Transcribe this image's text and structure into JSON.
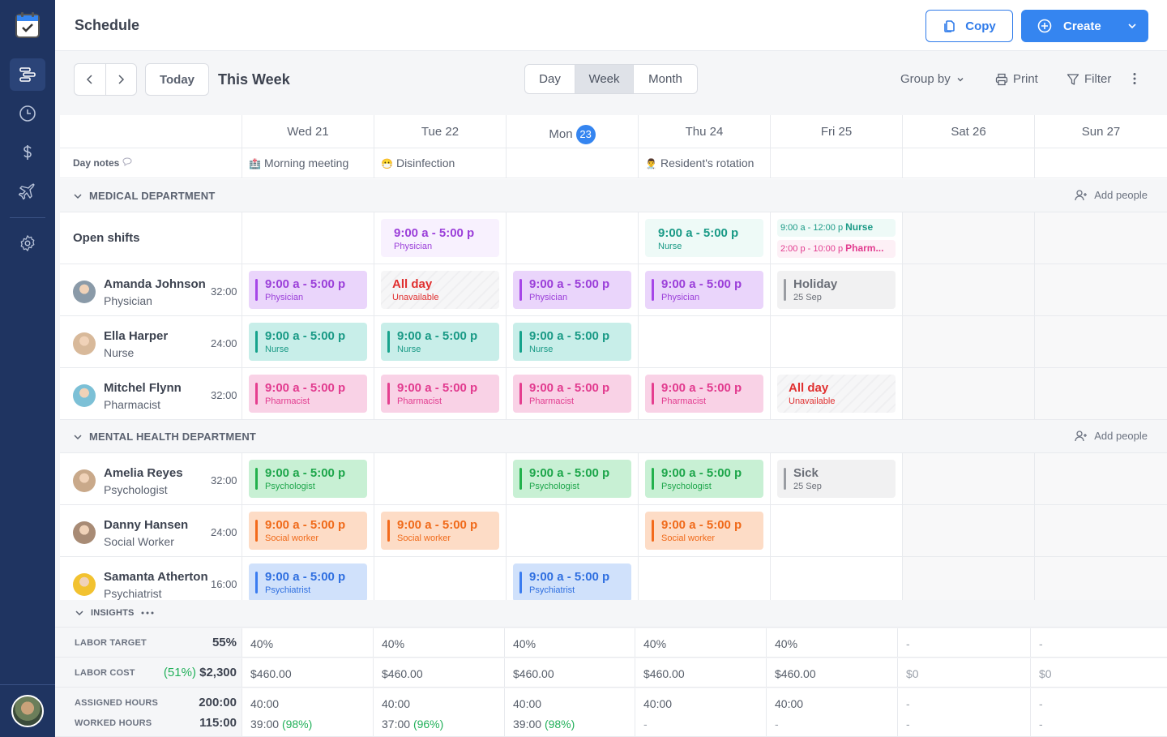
{
  "app": {
    "title": "Schedule"
  },
  "sidebar": {
    "items": [
      {
        "name": "schedule",
        "icon": "timeline-icon",
        "active": true
      },
      {
        "name": "time-clock",
        "icon": "clock-icon",
        "active": false
      },
      {
        "name": "payroll",
        "icon": "dollar-icon",
        "active": false
      },
      {
        "name": "time-off",
        "icon": "airplane-icon",
        "active": false
      },
      {
        "name": "settings",
        "icon": "gear-icon",
        "active": false
      }
    ]
  },
  "header": {
    "copy_label": "Copy",
    "create_label": "Create"
  },
  "toolbar": {
    "today_label": "Today",
    "range_title": "This Week",
    "views": [
      "Day",
      "Week",
      "Month"
    ],
    "active_view": "Week",
    "group_by_label": "Group by",
    "print_label": "Print",
    "filter_label": "Filter"
  },
  "days": [
    {
      "label": "Wed 21",
      "note": "Morning meeting",
      "note_icon": "🏥"
    },
    {
      "label": "Tue 22",
      "note": "Disinfection",
      "note_icon": "😷"
    },
    {
      "label": "Mon",
      "badge": "23",
      "note": ""
    },
    {
      "label": "Thu 24",
      "note": "Resident's rotation",
      "note_icon": "👨‍⚕️"
    },
    {
      "label": "Fri 25",
      "note": ""
    },
    {
      "label": "Sat 26",
      "note": ""
    },
    {
      "label": "Sun 27",
      "note": ""
    }
  ],
  "day_notes_label": "Day notes",
  "departments": [
    {
      "name": "MEDICAL DEPARTMENT",
      "add_people_label": "Add people",
      "open_shifts": {
        "label": "Open shifts",
        "cells": {
          "1": [
            {
              "time": "9:00 a - 5:00 p",
              "role": "Physician",
              "color": "purple"
            }
          ],
          "3": [
            {
              "time": "9:00 a - 5:00 p",
              "role": "Nurse",
              "color": "teal"
            }
          ],
          "4": [
            {
              "time": "9:00 a - 12:00 p",
              "role": "Nurse",
              "color": "teal"
            },
            {
              "time": "2:00 p - 10:00 p",
              "role": "Pharm...",
              "color": "pink"
            }
          ]
        }
      },
      "people": [
        {
          "name": "Amanda Johnson",
          "role": "Physician",
          "hours": "32:00",
          "shifts": [
            {
              "day": 0,
              "type": "shift",
              "time": "9:00 a - 5:00 p",
              "role": "Physician",
              "color": "purple"
            },
            {
              "day": 1,
              "type": "unavailable",
              "time": "All day",
              "role": "Unavailable"
            },
            {
              "day": 2,
              "type": "shift",
              "time": "9:00 a - 5:00 p",
              "role": "Physician",
              "color": "purple"
            },
            {
              "day": 3,
              "type": "shift",
              "time": "9:00 a - 5:00 p",
              "role": "Physician",
              "color": "purple"
            },
            {
              "day": 4,
              "type": "leave",
              "time": "Holiday",
              "role": "25 Sep",
              "color": "gray"
            }
          ]
        },
        {
          "name": "Ella Harper",
          "role": "Nurse",
          "hours": "24:00",
          "shifts": [
            {
              "day": 0,
              "type": "shift",
              "time": "9:00 a - 5:00 p",
              "role": "Nurse",
              "color": "teal"
            },
            {
              "day": 1,
              "type": "shift",
              "time": "9:00 a - 5:00 p",
              "role": "Nurse",
              "color": "teal"
            },
            {
              "day": 2,
              "type": "shift",
              "time": "9:00 a - 5:00 p",
              "role": "Nurse",
              "color": "teal"
            }
          ]
        },
        {
          "name": "Mitchel Flynn",
          "role": "Pharmacist",
          "hours": "32:00",
          "shifts": [
            {
              "day": 0,
              "type": "shift",
              "time": "9:00 a - 5:00 p",
              "role": "Pharmacist",
              "color": "pink"
            },
            {
              "day": 1,
              "type": "shift",
              "time": "9:00 a - 5:00 p",
              "role": "Pharmacist",
              "color": "pink"
            },
            {
              "day": 2,
              "type": "shift",
              "time": "9:00 a - 5:00 p",
              "role": "Pharmacist",
              "color": "pink"
            },
            {
              "day": 3,
              "type": "shift",
              "time": "9:00 a - 5:00 p",
              "role": "Pharmacist",
              "color": "pink"
            },
            {
              "day": 4,
              "type": "unavailable",
              "time": "All day",
              "role": "Unavailable"
            }
          ]
        }
      ]
    },
    {
      "name": "MENTAL HEALTH DEPARTMENT",
      "add_people_label": "Add people",
      "people": [
        {
          "name": "Amelia Reyes",
          "role": "Psychologist",
          "hours": "32:00",
          "shifts": [
            {
              "day": 0,
              "type": "shift",
              "time": "9:00 a - 5:00 p",
              "role": "Psychologist",
              "color": "green"
            },
            {
              "day": 2,
              "type": "shift",
              "time": "9:00 a - 5:00 p",
              "role": "Psychologist",
              "color": "green"
            },
            {
              "day": 3,
              "type": "shift",
              "time": "9:00 a - 5:00 p",
              "role": "Psychologist",
              "color": "green"
            },
            {
              "day": 4,
              "type": "leave",
              "time": "Sick",
              "role": "25 Sep",
              "color": "gray"
            }
          ]
        },
        {
          "name": "Danny Hansen",
          "role": "Social Worker",
          "hours": "24:00",
          "shifts": [
            {
              "day": 0,
              "type": "shift",
              "time": "9:00 a - 5:00 p",
              "role": "Social worker",
              "color": "orange"
            },
            {
              "day": 1,
              "type": "shift",
              "time": "9:00 a - 5:00 p",
              "role": "Social worker",
              "color": "orange"
            },
            {
              "day": 3,
              "type": "shift",
              "time": "9:00 a - 5:00 p",
              "role": "Social worker",
              "color": "orange"
            }
          ]
        },
        {
          "name": "Samanta Atherton",
          "role": "Psychiatrist",
          "hours": "16:00",
          "shifts": [
            {
              "day": 0,
              "type": "shift",
              "time": "9:00 a - 5:00 p",
              "role": "Psychiatrist",
              "color": "blue"
            },
            {
              "day": 2,
              "type": "shift",
              "time": "9:00 a - 5:00 p",
              "role": "Psychiatrist",
              "color": "blue"
            }
          ]
        }
      ]
    }
  ],
  "colors": {
    "purple": {
      "bg": "#ead5fb",
      "fg": "#9b3fd9",
      "bar": "#a646e8",
      "open_bg": "#f8f1fe"
    },
    "teal": {
      "bg": "#c8eee9",
      "fg": "#1a9a86",
      "bar": "#16a38c",
      "open_bg": "#eefaf7"
    },
    "pink": {
      "bg": "#f9d2e6",
      "fg": "#e23b8f",
      "bar": "#e53e8f",
      "open_bg": "#fdf0f6"
    },
    "green": {
      "bg": "#c8f0d4",
      "fg": "#1ea64b",
      "bar": "#22b14c",
      "open_bg": "#effbf2"
    },
    "orange": {
      "bg": "#fddcc6",
      "fg": "#f06a1a",
      "bar": "#f36a1b",
      "open_bg": "#fff2ea"
    },
    "blue": {
      "bg": "#d0e1fb",
      "fg": "#2f6fe0",
      "bar": "#3a7cf0",
      "open_bg": "#eef4fe"
    },
    "gray": {
      "bg": "#f1f1f2",
      "fg": "#6b6f78",
      "bar": "#9a9da3",
      "open_bg": "#f5f5f6"
    },
    "red": "#e03030",
    "accent": "#3585f0"
  },
  "insights": {
    "title": "INSIGHTS",
    "labor_target": {
      "label": "LABOR TARGET",
      "total": "55%",
      "values": [
        "40%",
        "40%",
        "40%",
        "40%",
        "40%",
        "-",
        "-"
      ]
    },
    "labor_cost": {
      "label": "LABOR COST",
      "pct": "(51%)",
      "total": "$2,300",
      "values": [
        "$460.00",
        "$460.00",
        "$460.00",
        "$460.00",
        "$460.00",
        "$0",
        "$0"
      ]
    },
    "assigned_hours": {
      "label": "ASSIGNED HOURS",
      "total": "200:00",
      "values": [
        "40:00",
        "40:00",
        "40:00",
        "40:00",
        "40:00",
        "-",
        "-"
      ]
    },
    "worked_hours": {
      "label": "WORKED HOURS",
      "total": "115:00",
      "values": [
        {
          "v": "39:00",
          "pct": "(98%)"
        },
        {
          "v": "37:00",
          "pct": "(96%)"
        },
        {
          "v": "39:00",
          "pct": "(98%)"
        },
        {
          "v": "-",
          "pct": ""
        },
        {
          "v": "-",
          "pct": ""
        },
        {
          "v": "-",
          "pct": ""
        },
        {
          "v": "-",
          "pct": ""
        }
      ]
    }
  }
}
